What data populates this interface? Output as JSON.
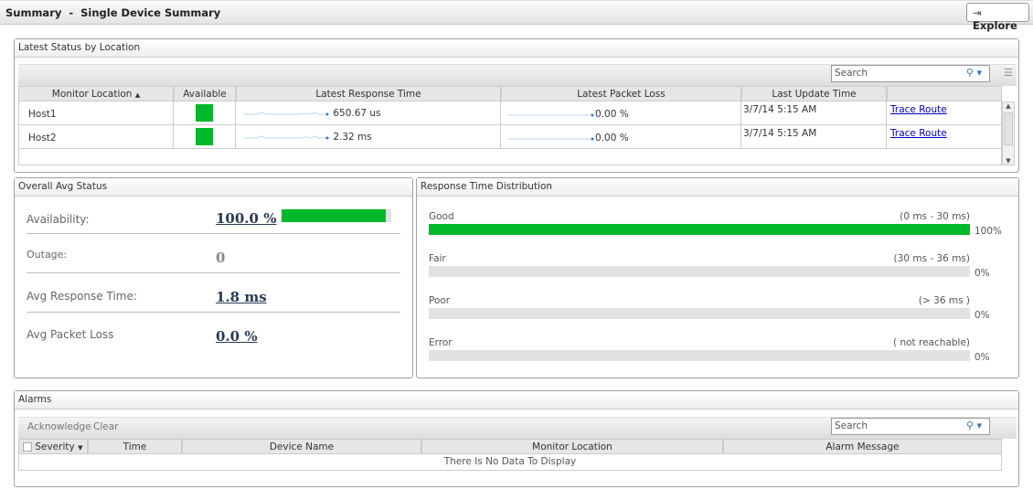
{
  "header": {
    "title": "Summary  -  Single Device Summary",
    "explore_label": "Explore"
  },
  "latest_status": {
    "title": "Latest Status by Location",
    "search_placeholder": "Search",
    "columns": [
      "Monitor Location",
      "Available",
      "Latest Response Time",
      "Latest Packet Loss",
      "Last Update Time",
      ""
    ],
    "rows": [
      {
        "location": "Host1",
        "available": true,
        "response": "650.67 us",
        "loss": "0.00 %",
        "updated": "3/7/14 5:15 AM",
        "action": "Trace Route"
      },
      {
        "location": "Host2",
        "available": true,
        "response": "2.32 ms",
        "loss": "0.00 %",
        "updated": "3/7/14 5:15 AM",
        "action": "Trace Route"
      }
    ]
  },
  "overall": {
    "title": "Overall Avg Status",
    "availability_label": "Availability:",
    "availability_value": "100.0 %",
    "availability_fraction": 0.95,
    "outage_label": "Outage:",
    "outage_value": "0",
    "response_label": "Avg Response Time:",
    "response_value": "1.8 ms",
    "loss_label": "Avg Packet Loss",
    "loss_value": "0.0 %"
  },
  "distribution": {
    "title": "Response Time Distribution",
    "items": [
      {
        "label": "Good",
        "range": "(0 ms - 30 ms)",
        "pct": "100%",
        "value": 100
      },
      {
        "label": "Fair",
        "range": "(30 ms - 36 ms)",
        "pct": "0%",
        "value": 0
      },
      {
        "label": "Poor",
        "range": "(> 36 ms )",
        "pct": "0%",
        "value": 0
      },
      {
        "label": "Error",
        "range": "( not reachable)",
        "pct": "0%",
        "value": 0
      }
    ]
  },
  "alarms": {
    "title": "Alarms",
    "acknowledge": "Acknowledge",
    "clear": "Clear",
    "search_placeholder": "Search",
    "columns": [
      "Severity",
      "Time",
      "Device Name",
      "Monitor Location",
      "Alarm Message"
    ],
    "empty": "There Is No Data To Display"
  },
  "colors": {
    "green": "#00b82a",
    "link": "#0000cc"
  }
}
